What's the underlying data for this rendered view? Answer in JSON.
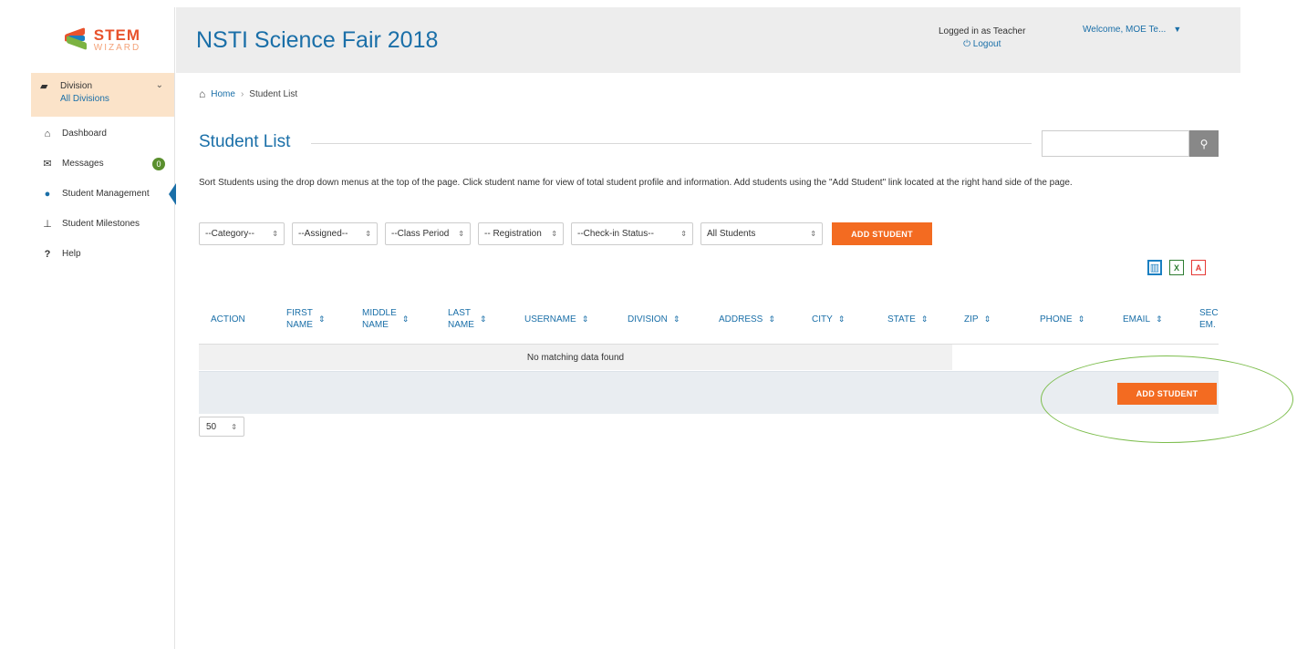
{
  "app": {
    "logo_stem": "STEM",
    "logo_wizard": "WIZARD",
    "title": "NSTI Science Fair 2018"
  },
  "header": {
    "logged_in_text": "Logged in as Teacher",
    "logout_label": "Logout",
    "welcome_label": "Welcome, MOE Te..."
  },
  "sidebar": {
    "division_label": "Division",
    "division_value": "All Divisions",
    "items": [
      {
        "label": "Dashboard",
        "icon": "home-icon"
      },
      {
        "label": "Messages",
        "icon": "envelope-icon",
        "badge": "0"
      },
      {
        "label": "Student Management",
        "icon": "user-icon",
        "active": true
      },
      {
        "label": "Student Milestones",
        "icon": "milestone-icon"
      },
      {
        "label": "Help",
        "icon": "question-icon"
      }
    ]
  },
  "breadcrumb": {
    "home": "Home",
    "current": "Student List"
  },
  "page": {
    "title": "Student List",
    "description": "Sort Students using the drop down menus at the top of the page. Click student name for view of total student profile and information. Add students using the \"Add Student\" link located at the right hand side of the page."
  },
  "filters": {
    "category": "--Category--",
    "assigned": "--Assigned--",
    "class_period": "--Class Period",
    "registration": "-- Registration",
    "checkin": "--Check-in Status--",
    "students": "All Students",
    "add_button": "ADD STUDENT"
  },
  "table": {
    "columns": [
      {
        "l1": "ACTION",
        "l2": ""
      },
      {
        "l1": "FIRST",
        "l2": "NAME"
      },
      {
        "l1": "MIDDLE",
        "l2": "NAME"
      },
      {
        "l1": "LAST",
        "l2": "NAME"
      },
      {
        "l1": "USERNAME",
        "l2": ""
      },
      {
        "l1": "DIVISION",
        "l2": ""
      },
      {
        "l1": "ADDRESS",
        "l2": ""
      },
      {
        "l1": "CITY",
        "l2": ""
      },
      {
        "l1": "STATE",
        "l2": ""
      },
      {
        "l1": "ZIP",
        "l2": ""
      },
      {
        "l1": "PHONE",
        "l2": ""
      },
      {
        "l1": "EMAIL",
        "l2": ""
      },
      {
        "l1": "SEC",
        "l2": "EM."
      }
    ],
    "empty_message": "No matching data found",
    "add_button_bottom": "ADD STUDENT",
    "page_size": "50"
  },
  "colors": {
    "brand_blue": "#1a6fa8",
    "accent_orange": "#f36b21",
    "division_bg": "#fbe3c9",
    "annotation_green": "#7cbd4c"
  }
}
